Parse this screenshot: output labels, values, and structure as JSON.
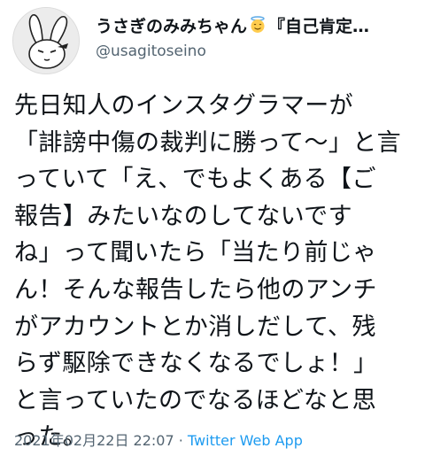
{
  "user": {
    "display_name": "うさぎのみみちゃん",
    "name_emoji": "smiling-face-with-halo-icon",
    "name_rest": "『自己肯定…",
    "handle": "@usagitoseino"
  },
  "tweet": {
    "lines": [
      "先日知人のインスタグラマーが",
      "「誹謗中傷の裁判に勝って〜」と言",
      "っていて「え、でもよくある【ご",
      "報告】みたいなのしてないです",
      "ね」って聞いたら「当たり前じゃ",
      "ん！そんな報告したら他のアンチ",
      "がアカウントとか消しだして、残",
      "らず駆除できなくなるでしょ！」",
      "と言っていたのでなるほどなと思",
      "った。"
    ]
  },
  "meta": {
    "timestamp": "2021年02月22日 22:07",
    "separator": " · ",
    "source": "Twitter Web App"
  },
  "colors": {
    "text": "#0f1419",
    "secondary": "#536471",
    "link": "#1d9bf0"
  }
}
